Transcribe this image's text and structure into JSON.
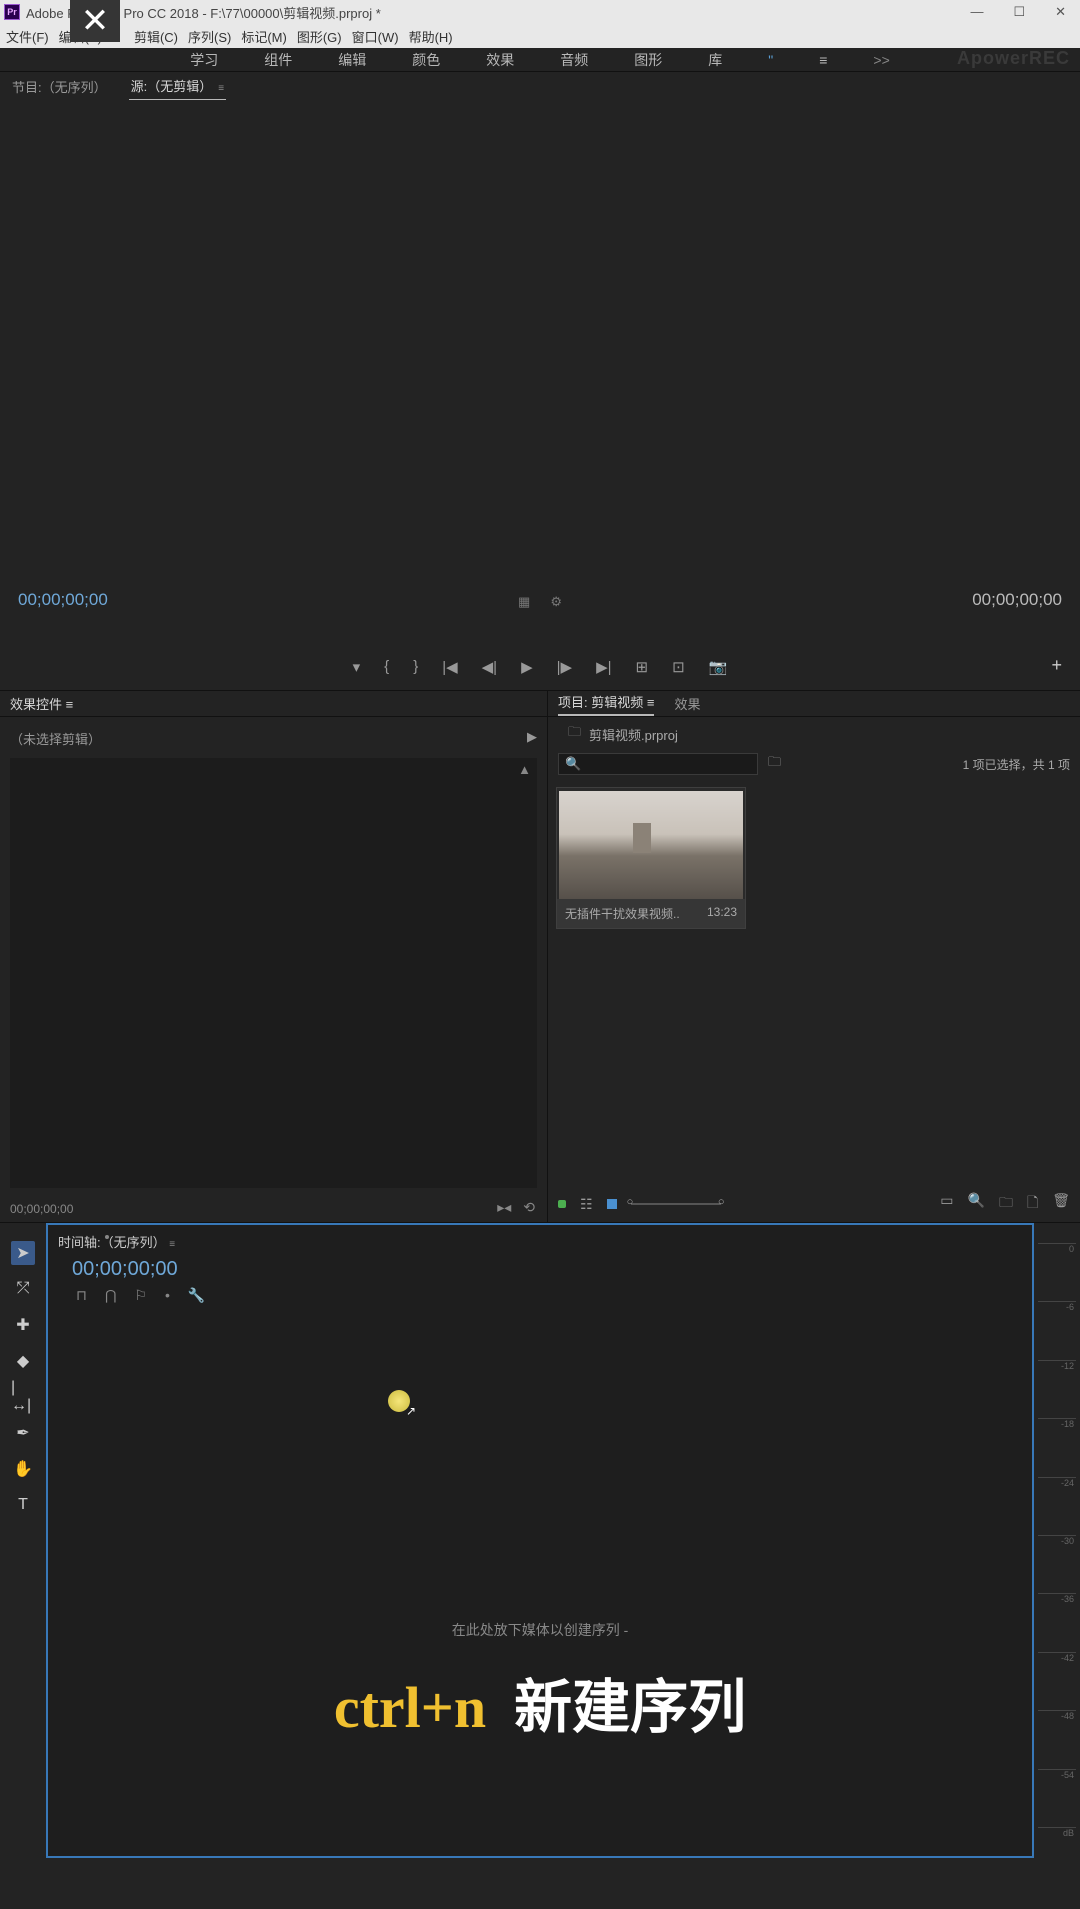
{
  "title_bar": {
    "app_name": "Adobe Premiere Pro CC 2018",
    "file_path": "F:\\77\\00000\\剪辑视频.prproj *",
    "full_title": "Adobe Premiere Pro CC 2018 - F:\\77\\00000\\剪辑视频.prproj *",
    "pr_icon": "Pr"
  },
  "menu": {
    "file": "文件(F)",
    "edit": "编辑(E)",
    "clip": "剪辑(C)",
    "sequence": "序列(S)",
    "marker": "标记(M)",
    "graphics": "图形(G)",
    "window": "窗口(W)",
    "help": "帮助(H)"
  },
  "workspaces": {
    "learning": "学习",
    "assembly": "组件",
    "editing": "编辑",
    "color": "颜色",
    "effects": "效果",
    "audio": "音频",
    "graphics": "图形",
    "library": "库",
    "more": ">>"
  },
  "watermark": "ApowerREC",
  "source_panel": {
    "tab_program": "节目:（无序列）",
    "tab_source": "源:（无剪辑）",
    "timecode_left": "00;00;00;00",
    "timecode_right": "00;00;00;00"
  },
  "effect_controls": {
    "title": "效果控件",
    "no_clip": "（未选择剪辑）",
    "footer_tc": "00;00;00;00"
  },
  "project": {
    "tab_project": "项目: 剪辑视频",
    "tab_effects": "效果",
    "file_label": "剪辑视频.prproj",
    "count": "1 项已选择，共 1 项",
    "clip": {
      "name": "无插件干扰效果视频..",
      "duration": "13:23"
    }
  },
  "timeline": {
    "tab": "时间轴:（无序列）",
    "timecode": "00;00;00;00",
    "drop_hint": "在此处放下媒体以创建序列 -"
  },
  "overlay": {
    "shortcut": "ctrl+n",
    "action": "新建序列"
  },
  "audio_scale": [
    "0",
    "-6",
    "-12",
    "-18",
    "-24",
    "-30",
    "-36",
    "-42",
    "-48",
    "-54",
    "dB"
  ]
}
